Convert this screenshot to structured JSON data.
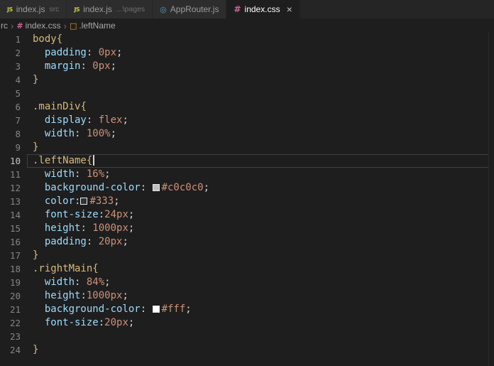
{
  "icons": {
    "js": "JS",
    "react": "◎",
    "css": "#",
    "class": "□",
    "close": "×"
  },
  "colors": {
    "editor_bg": "#1e1e1e",
    "tab_bar_bg": "#252526",
    "tab_inactive_bg": "#2d2d2d",
    "tab_active_bg": "#1e1e1e",
    "tab_inactive_fg": "#9b9b9b",
    "tab_active_fg": "#ffffff",
    "breadcrumb_fg": "#a9a9a9",
    "line_number_fg": "#858585",
    "line_number_active_fg": "#c6c6c6",
    "current_line_border": "#3f3f46",
    "js_icon": "#cbcb41",
    "react_icon": "#519aba",
    "css_icon": "#cc6699",
    "class_icon": "#ee9d28",
    "token": {
      "sel": "#d7ba7d",
      "brace": "#d7ba7d",
      "prop": "#9cdcfe",
      "val": "#ce9178",
      "punct": "#d4d4d4",
      "plain": "#d4d4d4"
    }
  },
  "tabs": [
    {
      "label": "index.js",
      "description": "src",
      "icon": "js",
      "active": false,
      "close": false
    },
    {
      "label": "index.js",
      "description": "...\\pages",
      "icon": "js",
      "active": false,
      "close": false
    },
    {
      "label": "AppRouter.js",
      "description": "",
      "icon": "react",
      "active": false,
      "close": false
    },
    {
      "label": "index.css",
      "description": "",
      "icon": "css",
      "active": true,
      "close": true
    }
  ],
  "breadcrumb": {
    "separator": "›",
    "items": [
      {
        "label": "rc",
        "icon": ""
      },
      {
        "label": "index.css",
        "icon": "css"
      },
      {
        "label": ".leftName",
        "icon": "class"
      }
    ]
  },
  "editor": {
    "lines": [
      {
        "num": 1,
        "tokens": [
          [
            "sel",
            "body"
          ],
          [
            "brace",
            "{"
          ]
        ]
      },
      {
        "num": 2,
        "tokens": [
          [
            "plain",
            "  "
          ],
          [
            "prop",
            "padding"
          ],
          [
            "punct",
            ": "
          ],
          [
            "val",
            "0px"
          ],
          [
            "punct",
            ";"
          ]
        ]
      },
      {
        "num": 3,
        "tokens": [
          [
            "plain",
            "  "
          ],
          [
            "prop",
            "margin"
          ],
          [
            "punct",
            ": "
          ],
          [
            "val",
            "0px"
          ],
          [
            "punct",
            ";"
          ]
        ]
      },
      {
        "num": 4,
        "tokens": [
          [
            "brace",
            "}"
          ]
        ]
      },
      {
        "num": 5,
        "tokens": []
      },
      {
        "num": 6,
        "tokens": [
          [
            "sel",
            ".mainDiv"
          ],
          [
            "brace",
            "{"
          ]
        ]
      },
      {
        "num": 7,
        "tokens": [
          [
            "plain",
            "  "
          ],
          [
            "prop",
            "display"
          ],
          [
            "punct",
            ": "
          ],
          [
            "val",
            "flex"
          ],
          [
            "punct",
            ";"
          ]
        ]
      },
      {
        "num": 8,
        "tokens": [
          [
            "plain",
            "  "
          ],
          [
            "prop",
            "width"
          ],
          [
            "punct",
            ": "
          ],
          [
            "val",
            "100%"
          ],
          [
            "punct",
            ";"
          ]
        ]
      },
      {
        "num": 9,
        "tokens": [
          [
            "brace",
            "}"
          ]
        ]
      },
      {
        "num": 10,
        "current": true,
        "cursor": true,
        "tokens": [
          [
            "sel",
            ".leftName"
          ],
          [
            "brace",
            "{"
          ]
        ]
      },
      {
        "num": 11,
        "tokens": [
          [
            "plain",
            "  "
          ],
          [
            "prop",
            "width"
          ],
          [
            "punct",
            ": "
          ],
          [
            "val",
            "16%"
          ],
          [
            "punct",
            ";"
          ]
        ]
      },
      {
        "num": 12,
        "tokens": [
          [
            "plain",
            "  "
          ],
          [
            "prop",
            "background-color"
          ],
          [
            "punct",
            ": "
          ],
          [
            "swatch",
            "#c0c0c0"
          ],
          [
            "val",
            "#c0c0c0"
          ],
          [
            "punct",
            ";"
          ]
        ]
      },
      {
        "num": 13,
        "tokens": [
          [
            "plain",
            "  "
          ],
          [
            "prop",
            "color"
          ],
          [
            "punct",
            ":"
          ],
          [
            "swatch",
            "#333"
          ],
          [
            "val",
            "#333"
          ],
          [
            "punct",
            ";"
          ]
        ]
      },
      {
        "num": 14,
        "tokens": [
          [
            "plain",
            "  "
          ],
          [
            "prop",
            "font-size"
          ],
          [
            "punct",
            ":"
          ],
          [
            "val",
            "24px"
          ],
          [
            "punct",
            ";"
          ]
        ]
      },
      {
        "num": 15,
        "tokens": [
          [
            "plain",
            "  "
          ],
          [
            "prop",
            "height"
          ],
          [
            "punct",
            ": "
          ],
          [
            "val",
            "1000px"
          ],
          [
            "punct",
            ";"
          ]
        ]
      },
      {
        "num": 16,
        "tokens": [
          [
            "plain",
            "  "
          ],
          [
            "prop",
            "padding"
          ],
          [
            "punct",
            ": "
          ],
          [
            "val",
            "20px"
          ],
          [
            "punct",
            ";"
          ]
        ]
      },
      {
        "num": 17,
        "tokens": [
          [
            "brace",
            "}"
          ]
        ]
      },
      {
        "num": 18,
        "tokens": [
          [
            "sel",
            ".rightMain"
          ],
          [
            "brace",
            "{"
          ]
        ]
      },
      {
        "num": 19,
        "tokens": [
          [
            "plain",
            "  "
          ],
          [
            "prop",
            "width"
          ],
          [
            "punct",
            ": "
          ],
          [
            "val",
            "84%"
          ],
          [
            "punct",
            ";"
          ]
        ]
      },
      {
        "num": 20,
        "tokens": [
          [
            "plain",
            "  "
          ],
          [
            "prop",
            "height"
          ],
          [
            "punct",
            ":"
          ],
          [
            "val",
            "1000px"
          ],
          [
            "punct",
            ";"
          ]
        ]
      },
      {
        "num": 21,
        "tokens": [
          [
            "plain",
            "  "
          ],
          [
            "prop",
            "background-color"
          ],
          [
            "punct",
            ": "
          ],
          [
            "swatch",
            "#fff"
          ],
          [
            "val",
            "#fff"
          ],
          [
            "punct",
            ";"
          ]
        ]
      },
      {
        "num": 22,
        "tokens": [
          [
            "plain",
            "  "
          ],
          [
            "prop",
            "font-size"
          ],
          [
            "punct",
            ":"
          ],
          [
            "val",
            "20px"
          ],
          [
            "punct",
            ";"
          ]
        ]
      },
      {
        "num": 23,
        "tokens": []
      },
      {
        "num": 24,
        "tokens": [
          [
            "brace",
            "}"
          ]
        ]
      }
    ]
  }
}
